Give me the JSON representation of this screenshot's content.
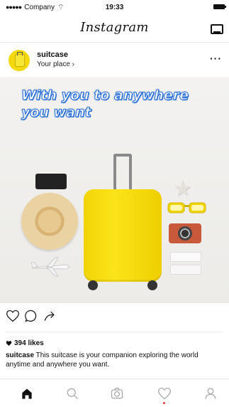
{
  "status_bar": {
    "carrier": "Company",
    "time": "19:33"
  },
  "nav": {
    "logo": "Instagram"
  },
  "post": {
    "username": "suitcase",
    "location": "Your place ›",
    "image_text": [
      "With you to anywhere",
      "you want"
    ],
    "likes": "394 likes",
    "caption_user": "suitcase",
    "caption_text": " This suitcase is your companion exploring the world anytime and anywhere you want."
  },
  "colors": {
    "accent": "#2a6fd8",
    "suitcase": "#f4d80e",
    "notification": "#e33333"
  },
  "icons": [
    "inbox-icon",
    "more-icon",
    "heart-icon",
    "comment-icon",
    "share-icon",
    "home-icon",
    "search-icon",
    "camera-icon",
    "activity-icon",
    "profile-icon"
  ]
}
